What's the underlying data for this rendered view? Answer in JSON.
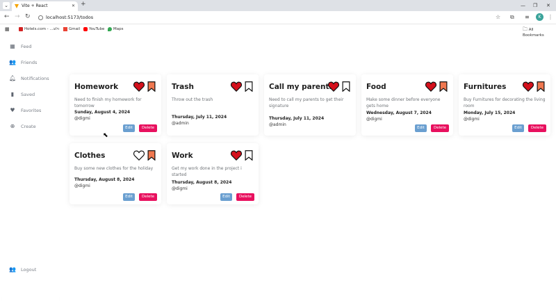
{
  "browser": {
    "tab_title": "Vite + React",
    "url": "localhost:5173/todos",
    "bookmarks": [
      "Hotels.com - ...ולוג",
      "Gmail",
      "YouTube",
      "Maps"
    ],
    "all_bookmarks": "All Bookmarks",
    "profile_initial": "K"
  },
  "sidebar": {
    "items": [
      {
        "label": "Feed",
        "icon": "dashboard-icon"
      },
      {
        "label": "Friends",
        "icon": "people-icon"
      },
      {
        "label": "Notifications",
        "icon": "bell-icon"
      },
      {
        "label": "Saved",
        "icon": "bookmark-icon"
      },
      {
        "label": "Favorites",
        "icon": "heart-icon"
      },
      {
        "label": "Create",
        "icon": "plus-circle-icon"
      }
    ],
    "logout": "Logout"
  },
  "todos": [
    {
      "title": "Homework",
      "desc": "Need to finish my homework for tomorrow",
      "date": "Sunday, August 4, 2024",
      "user": "@digmi",
      "liked": true,
      "saved": true,
      "edit": "Edit",
      "delete": "Delete"
    },
    {
      "title": "Trash",
      "desc": "Throw out the trash",
      "date": "Thursday, July 11, 2024",
      "user": "@admin",
      "liked": true,
      "saved": false,
      "edit": "",
      "delete": ""
    },
    {
      "title": "Call my parents",
      "desc": "Need to call my parents to get their signature",
      "date": "Thursday, July 11, 2024",
      "user": "@admin",
      "liked": true,
      "saved": false,
      "edit": "",
      "delete": ""
    },
    {
      "title": "Food",
      "desc": "Make some dinner before everyone gets home",
      "date": "Wednesday, August 7, 2024",
      "user": "@digmi",
      "liked": true,
      "saved": true,
      "edit": "Edit",
      "delete": "Delete"
    },
    {
      "title": "Furnitures",
      "desc": "Buy Furnitures for decorating the living room",
      "date": "Monday, July 15, 2024",
      "user": "@digmi",
      "liked": true,
      "saved": true,
      "edit": "Edit",
      "delete": "Delete"
    },
    {
      "title": "Clothes",
      "desc": "Buy some new clothes for the holiday",
      "date": "Thursday, August 8, 2024",
      "user": "@digmi",
      "liked": false,
      "saved": true,
      "edit": "Edit",
      "delete": "Delete"
    },
    {
      "title": "Work",
      "desc": "Get my work done in the project i started",
      "date": "Thursday, August 8, 2024",
      "user": "@digmi",
      "liked": true,
      "saved": false,
      "edit": "Edit",
      "delete": "Delete"
    }
  ],
  "colors": {
    "heart": "#d4101c",
    "bookmark": "#f07850",
    "edit": "#6a9fd0",
    "delete": "#e8105e"
  }
}
